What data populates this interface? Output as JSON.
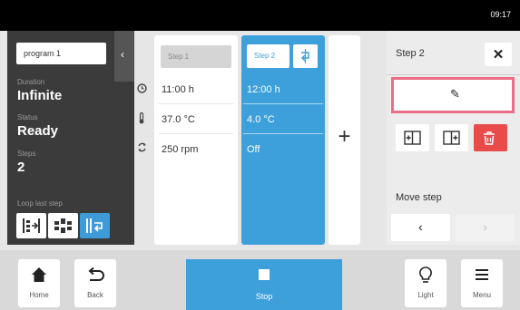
{
  "status_bar": {
    "time": "09:17"
  },
  "program": {
    "name": "program 1",
    "duration_label": "Duration",
    "duration_value": "Infinite",
    "status_label": "Status",
    "status_value": "Ready",
    "steps_label": "Steps",
    "steps_value": "2",
    "loop_label": "Loop last step"
  },
  "row_icons": [
    "clock-icon",
    "thermometer-icon",
    "rotation-icon"
  ],
  "steps": [
    {
      "label": "Step 1",
      "time": "11:00 h",
      "temp": "37.0 °C",
      "speed": "250 rpm"
    },
    {
      "label": "Step 2",
      "time": "12:00 h",
      "temp": "4.0 °C",
      "speed": "Off"
    }
  ],
  "add_step_symbol": "+",
  "edit": {
    "title": "Step 2",
    "close_symbol": "✕",
    "move_label": "Move step",
    "move_left": "‹",
    "move_right": "›"
  },
  "nav": {
    "home": "Home",
    "back": "Back",
    "stop": "Stop",
    "light": "Light",
    "menu": "Menu"
  },
  "colors": {
    "accent": "#3ea0db",
    "delete": "#e94b4b",
    "highlight": "#ea6f86",
    "panel_dark": "#3b3b3b"
  }
}
